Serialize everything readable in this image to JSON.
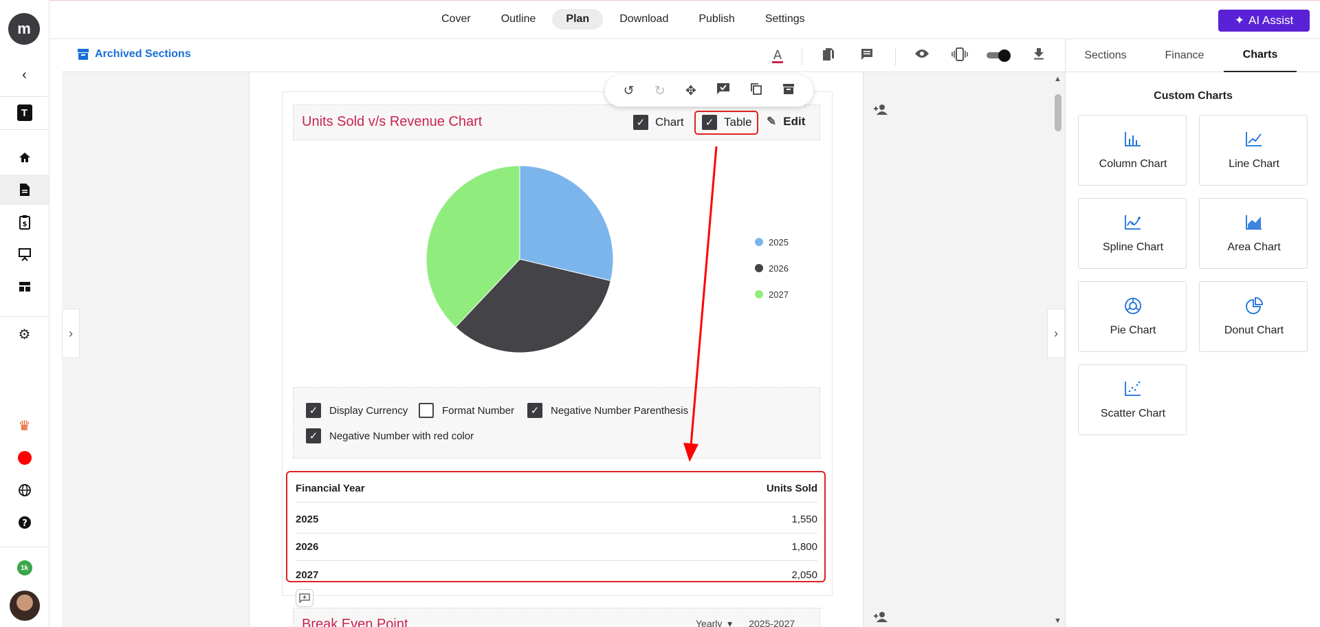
{
  "top_nav": {
    "tabs": [
      "Cover",
      "Outline",
      "Plan",
      "Download",
      "Publish",
      "Settings"
    ],
    "active_tab": "Plan",
    "ai_assist_label": "AI Assist"
  },
  "left_rail": {
    "logo_icon": "brand-logo-icon",
    "workspace_letter": "T",
    "badge_count": "1k"
  },
  "toolbar": {
    "archived_label": "Archived Sections"
  },
  "chart_block": {
    "title": "Units Sold v/s Revenue Chart",
    "chart_toggle_label": "Chart",
    "table_toggle_label": "Table",
    "edit_label": "Edit",
    "options": [
      {
        "label": "Display Currency",
        "checked": true
      },
      {
        "label": "Format Number",
        "checked": false
      },
      {
        "label": "Negative Number Parenthesis",
        "checked": true
      },
      {
        "label": "Negative Number with red color",
        "checked": true
      }
    ],
    "table": {
      "headers": [
        "Financial Year",
        "Units Sold"
      ],
      "rows": [
        {
          "year": "2025",
          "value": "1,550"
        },
        {
          "year": "2026",
          "value": "1,800"
        },
        {
          "year": "2027",
          "value": "2,050"
        }
      ]
    }
  },
  "chart_data": {
    "type": "pie",
    "categories": [
      "2025",
      "2026",
      "2027"
    ],
    "values": [
      1550,
      1800,
      2050
    ],
    "colors": [
      "#7cb5ec",
      "#434348",
      "#90ed7d"
    ],
    "legend_position": "right"
  },
  "next_block": {
    "title": "Break Even Point",
    "period": "Yearly",
    "range": "2025-2027"
  },
  "right_panel": {
    "tabs": [
      "Sections",
      "Finance",
      "Charts"
    ],
    "active_tab": "Charts",
    "title": "Custom Charts",
    "charts": [
      {
        "label": "Column Chart",
        "icon": "column-chart-icon"
      },
      {
        "label": "Line Chart",
        "icon": "line-chart-icon"
      },
      {
        "label": "Spline Chart",
        "icon": "spline-chart-icon"
      },
      {
        "label": "Area Chart",
        "icon": "area-chart-icon"
      },
      {
        "label": "Pie Chart",
        "icon": "pie-chart-icon"
      },
      {
        "label": "Donut Chart",
        "icon": "donut-chart-icon"
      },
      {
        "label": "Scatter Chart",
        "icon": "scatter-chart-icon"
      }
    ]
  },
  "colors": {
    "accent_purple": "#5a22d6",
    "title_red": "#c8234f",
    "link_blue": "#1a6fd8",
    "highlight_red": "#e02020"
  }
}
